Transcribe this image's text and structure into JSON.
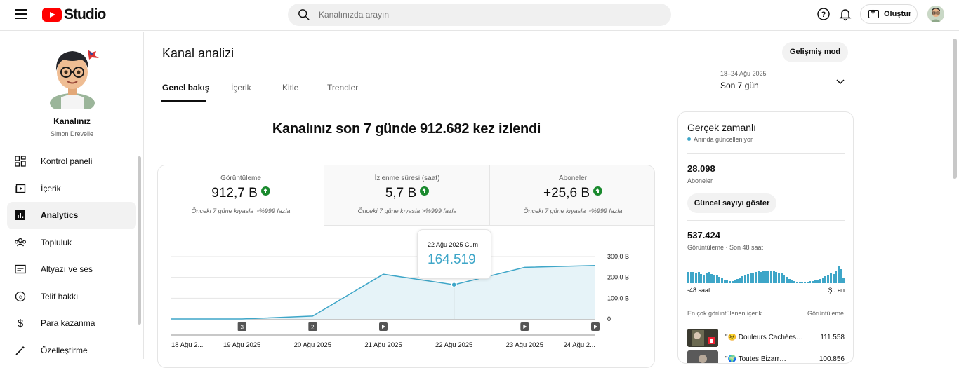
{
  "topbar": {
    "brand": "Studio",
    "search_placeholder": "Kanalınızda arayın",
    "create_label": "Oluştur"
  },
  "sidebar": {
    "channel_name": "Kanalınız",
    "channel_owner": "Simon Drevelle",
    "items": [
      {
        "label": "Kontrol paneli",
        "icon": "dashboard-icon"
      },
      {
        "label": "İçerik",
        "icon": "content-icon"
      },
      {
        "label": "Analytics",
        "icon": "analytics-icon",
        "active": true
      },
      {
        "label": "Topluluk",
        "icon": "community-icon"
      },
      {
        "label": "Altyazı ve ses",
        "icon": "subtitles-icon"
      },
      {
        "label": "Telif hakkı",
        "icon": "copyright-icon"
      },
      {
        "label": "Para kazanma",
        "icon": "dollar-icon"
      },
      {
        "label": "Özelleştirme",
        "icon": "magic-wand-icon"
      }
    ]
  },
  "header": {
    "title": "Kanal analizi",
    "advanced_mode": "Gelişmiş mod",
    "tabs": [
      "Genel bakış",
      "İçerik",
      "Kitle",
      "Trendler"
    ],
    "date_range": "18–24 Ağu 2025",
    "period": "Son 7 gün"
  },
  "overview": {
    "headline": "Kanalınız son 7 günde 912.682 kez izlendi",
    "metrics": [
      {
        "label": "Görüntüleme",
        "value": "912,7 B",
        "compare": "Önceki 7 güne kıyasla >%999 fazla"
      },
      {
        "label": "İzlenme süresi (saat)",
        "value": "5,7 B",
        "compare": "Önceki 7 güne kıyasla >%999 fazla"
      },
      {
        "label": "Aboneler",
        "value": "+25,6 B",
        "compare": "Önceki 7 güne kıyasla >%999 fazla"
      }
    ],
    "tooltip": {
      "date": "22 Ağu 2025 Cum",
      "value": "164.519"
    }
  },
  "chart_data": {
    "type": "area",
    "x": [
      "18 Ağu 2025",
      "19 Ağu 2025",
      "20 Ağu 2025",
      "21 Ağu 2025",
      "22 Ağu 2025",
      "23 Ağu 2025",
      "24 Ağu 2025"
    ],
    "x_tick_labels": [
      "18 Ağu 2...",
      "19 Ağu 2025",
      "20 Ağu 2025",
      "21 Ağu 2025",
      "22 Ağu 2025",
      "23 Ağu 2025",
      "24 Ağu 2..."
    ],
    "values": [
      0,
      0,
      14000,
      215000,
      164519,
      248000,
      257000
    ],
    "yticks": [
      "300,0 B",
      "200,0 B",
      "100,0 B",
      "0"
    ],
    "ylim": [
      0,
      300000
    ],
    "markers": [
      "",
      "3",
      "2",
      "short",
      "",
      "short",
      "short"
    ],
    "color": "#3ea6c8"
  },
  "realtime": {
    "title": "Gerçek zamanlı",
    "status": "Anında güncelleniyor",
    "subscribers": "28.098",
    "subscribers_label": "Aboneler",
    "show_count": "Güncel sayıyı göster",
    "views": "537.424",
    "views_label": "Görüntüleme · Son 48 saat",
    "axis_left": "-48 saat",
    "axis_right": "Şu an",
    "top_content_label": "En çok görüntülenen içerik",
    "top_views_label": "Görüntüleme",
    "bars": [
      17,
      17,
      17,
      16,
      17,
      14,
      12,
      15,
      17,
      14,
      12,
      12,
      10,
      8,
      5,
      4,
      3,
      3,
      4,
      6,
      8,
      11,
      13,
      14,
      15,
      16,
      17,
      18,
      17,
      19,
      19,
      18,
      19,
      18,
      17,
      16,
      15,
      13,
      10,
      7,
      5,
      3,
      2,
      2,
      2,
      2,
      2,
      3,
      3,
      4,
      5,
      7,
      9,
      11,
      12,
      15,
      14,
      18,
      26,
      22,
      8
    ],
    "videos": [
      {
        "title": "\"😣 Douleurs Cachées…",
        "views": "111.558"
      },
      {
        "title": "\"🌍 Toutes Bizarr…",
        "views": "100.856"
      }
    ]
  }
}
